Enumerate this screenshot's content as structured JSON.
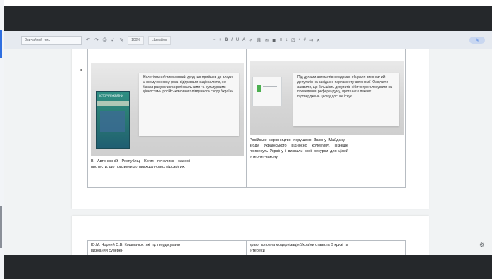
{
  "toolbar": {
    "style_select": "Звичайний текст",
    "zoom": "100%",
    "font": "Liberation",
    "icons": [
      "undo-icon",
      "redo-icon",
      "print-icon",
      "spellcheck-icon",
      "paint-format-icon"
    ],
    "format_icons": [
      "bold-icon",
      "italic-icon",
      "underline-icon",
      "text-color-icon",
      "highlight-icon",
      "link-icon",
      "comment-icon",
      "image-icon",
      "align-icon",
      "list-icon"
    ],
    "edit_label": "✎"
  },
  "page1": {
    "cell1": {
      "callout": "Нелегітимний тимчасовий уряд, що прийшов до влади, а якому основну роль відігравали націоналісти, не бажав рахуватися з регіональними та культурними цінностями російськомовного південного сходу України",
      "book_title": "ІСТОРІЯ УКРАЇНИ",
      "body": "В Автономній Республіці Крим почалися масові протести, що призвели до приходу нових підозрілих"
    },
    "cell2": {
      "callout": "Під дулами автоматів невідомих обирали виконавчий депутатів на засіданні парламенту автономії. Озвучити заявили, що більшість депутатів нібито проголосували на проведення референдуму, проте незалежних підтверджень цьому досі не існує.",
      "body": "Російське керівництво порушено Закону Майдану і згоду Українського відносно колегіуму. Пізніше принесуть Україну і визнали свої ресурси для цілей інтернет-закону"
    }
  },
  "page2": {
    "cell1": "Ю.М. Чорний С.В. Кошманюк, які підтверджували визнаний суверен",
    "cell2": "краю, головна модернізація України ставила В кризі та інтереси"
  },
  "side_icon": "⚙"
}
